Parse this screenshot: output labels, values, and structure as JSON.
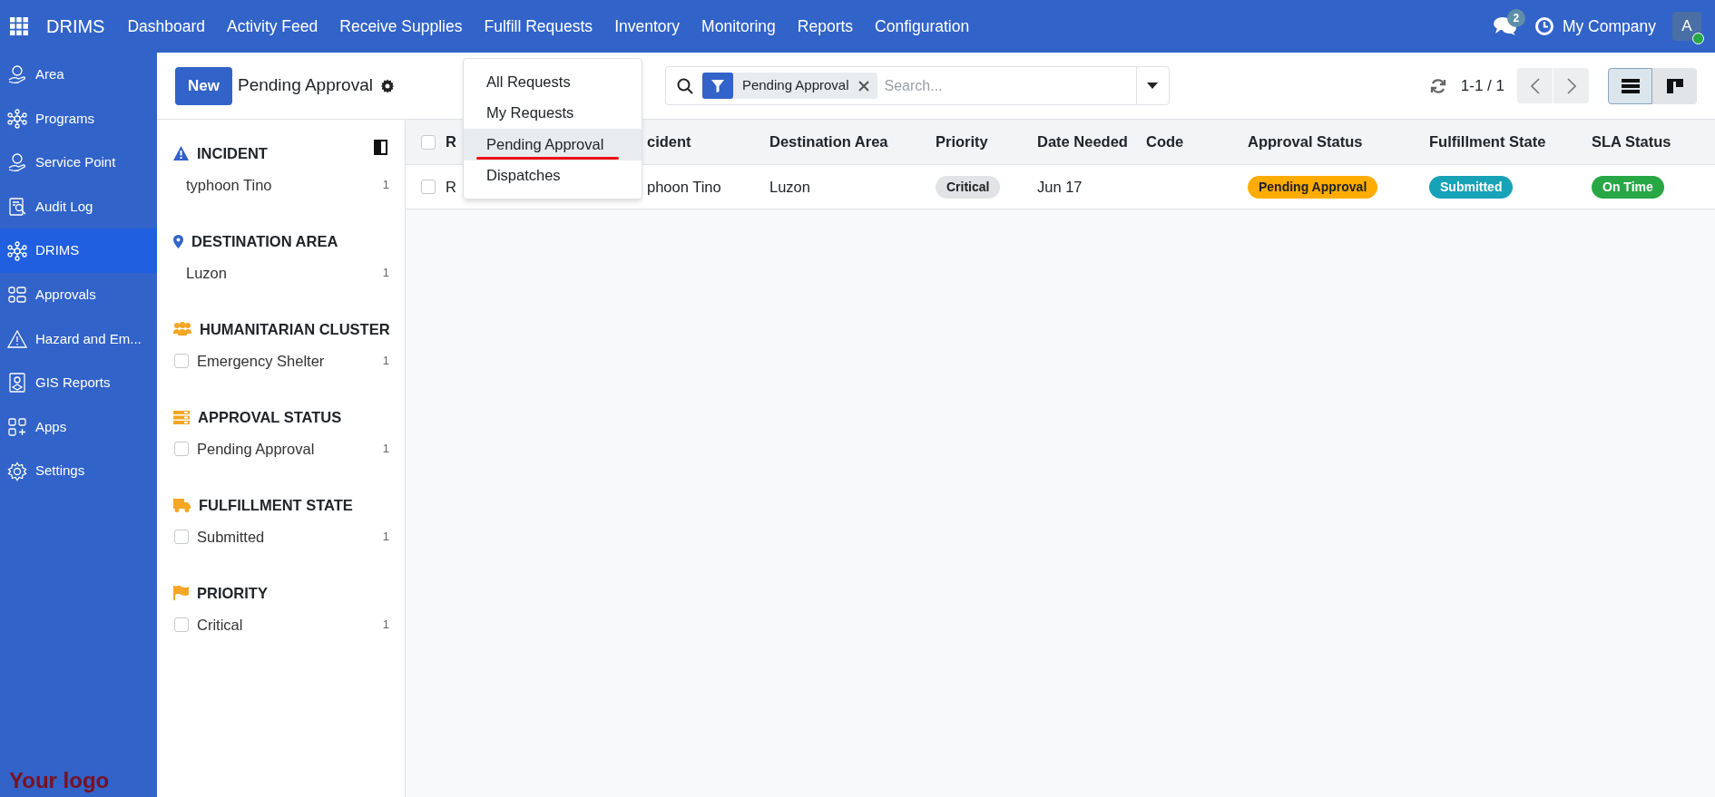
{
  "app": {
    "name": "DRIMS"
  },
  "top_menu": [
    "Dashboard",
    "Activity Feed",
    "Receive Supplies",
    "Fulfill Requests",
    "Inventory",
    "Monitoring",
    "Reports",
    "Configuration"
  ],
  "top_right": {
    "messages_count": "2",
    "company": "My Company",
    "avatar": "A"
  },
  "sidebar": {
    "items": [
      {
        "label": "Area",
        "selected": false
      },
      {
        "label": "Programs",
        "selected": false
      },
      {
        "label": "Service Point",
        "selected": false
      },
      {
        "label": "Audit Log",
        "selected": false
      },
      {
        "label": "DRIMS",
        "selected": true
      },
      {
        "label": "Approvals",
        "selected": false
      },
      {
        "label": "Hazard and Em...",
        "selected": false
      },
      {
        "label": "GIS Reports",
        "selected": false
      },
      {
        "label": "Apps",
        "selected": false
      },
      {
        "label": "Settings",
        "selected": false
      }
    ],
    "logo": "Your logo"
  },
  "control_panel": {
    "new_button": "New",
    "title": "Pending Approval",
    "facet": "Pending Approval",
    "search_placeholder": "Search...",
    "pager": "1-1 / 1",
    "views": [
      {
        "kind": "list",
        "selected": true
      },
      {
        "kind": "kanban",
        "selected": false
      }
    ]
  },
  "favorites_menu": {
    "items": [
      {
        "label": "All Requests",
        "selected": false
      },
      {
        "label": "My Requests",
        "selected": false
      },
      {
        "label": "Pending Approval",
        "selected": true
      },
      {
        "label": "Dispatches",
        "selected": false
      }
    ]
  },
  "filter_panel": {
    "sections": [
      {
        "title": "INCIDENT",
        "items": [
          {
            "kind": "plain",
            "label": "typhoon Tino",
            "count": "1"
          }
        ]
      },
      {
        "title": "DESTINATION AREA",
        "items": [
          {
            "kind": "plain",
            "label": "Luzon",
            "count": "1"
          }
        ]
      },
      {
        "title": "HUMANITARIAN CLUSTER",
        "items": [
          {
            "kind": "checkbox",
            "label": "Emergency Shelter",
            "count": "1",
            "checked": false
          }
        ]
      },
      {
        "title": "APPROVAL STATUS",
        "items": [
          {
            "kind": "checkbox",
            "label": "Pending Approval",
            "count": "1",
            "checked": false
          }
        ]
      },
      {
        "title": "FULFILLMENT STATE",
        "items": [
          {
            "kind": "checkbox",
            "label": "Submitted",
            "count": "1",
            "checked": false
          }
        ]
      },
      {
        "title": "PRIORITY",
        "items": [
          {
            "kind": "checkbox",
            "label": "Critical",
            "count": "1",
            "checked": false
          }
        ]
      }
    ]
  },
  "table": {
    "all_checked": false,
    "columns": [
      "R",
      "cident",
      "Destination Area",
      "Priority",
      "Date Needed",
      "Code",
      "Approval Status",
      "Fulfillment State",
      "SLA Status"
    ],
    "rows": [
      {
        "checked": false,
        "cells": [
          {
            "kind": "text",
            "text": "R"
          },
          {
            "kind": "text",
            "text": "phoon Tino"
          },
          {
            "kind": "text",
            "text": "Luzon"
          },
          {
            "kind": "badge",
            "text": "Critical",
            "color": "#e2e3e6"
          },
          {
            "kind": "text",
            "text": "Jun 17"
          },
          {
            "kind": "text",
            "text": ""
          },
          {
            "kind": "badge",
            "text": "Pending Approval",
            "color": "#ffac00"
          },
          {
            "kind": "badge",
            "text": "Submitted",
            "color": "#17a2b8"
          },
          {
            "kind": "badge",
            "text": "On Time",
            "color": "#28a745"
          }
        ]
      }
    ]
  }
}
